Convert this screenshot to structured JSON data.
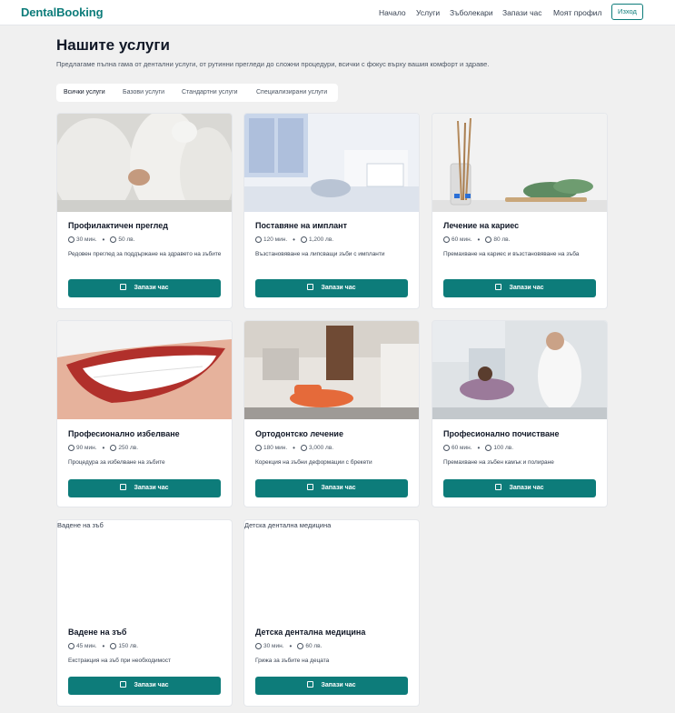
{
  "nav": {
    "brand": "DentalBooking",
    "links": [
      "Начало",
      "Услуги",
      "Зъболекари",
      "Запази час",
      "Моят профил"
    ],
    "logout": "Изход"
  },
  "page": {
    "title": "Нашите услуги",
    "subtitle": "Предлагаме пълна гама от дентални услуги, от рутинни прегледи до сложни процедури, всички с фокус върху вашия комфорт и здраве."
  },
  "tabs": [
    "Всички услуги",
    "Базови услуги",
    "Стандартни услуги",
    "Специализирани услуги"
  ],
  "book_label": "Запази час",
  "services": [
    {
      "title": "Профилактичен преглед",
      "duration": "30 мин.",
      "price": "50 лв.",
      "desc": "Редовен преглед за поддържане на здравето на зъбите",
      "image_alt": ""
    },
    {
      "title": "Поставяне на имплант",
      "duration": "120 мин.",
      "price": "1,200 лв.",
      "desc": "Възстановяване на липсващи зъби с импланти",
      "image_alt": ""
    },
    {
      "title": "Лечение на кариес",
      "duration": "60 мин.",
      "price": "80 лв.",
      "desc": "Премахване на кариес и възстановяване на зъба",
      "image_alt": ""
    },
    {
      "title": "Професионално избелване",
      "duration": "90 мин.",
      "price": "250 лв.",
      "desc": "Процедура за избелване на зъбите",
      "image_alt": ""
    },
    {
      "title": "Ортодонтско лечение",
      "duration": "180 мин.",
      "price": "3,000 лв.",
      "desc": "Корекция на зъбни деформации с брекети",
      "image_alt": ""
    },
    {
      "title": "Професионално почистване",
      "duration": "60 мин.",
      "price": "100 лв.",
      "desc": "Премахване на зъбен камък и полиране",
      "image_alt": ""
    },
    {
      "title": "Вадене на зъб",
      "duration": "45 мин.",
      "price": "150 лв.",
      "desc": "Екстракция на зъб при необходимост",
      "image_alt": "Вадене на зъб"
    },
    {
      "title": "Детска дентална медицина",
      "duration": "30 мин.",
      "price": "60 лв.",
      "desc": "Грижа за зъбите на децата",
      "image_alt": "Детска дентална медицина"
    }
  ],
  "colors": {
    "accent": "#0d7c7a",
    "background": "#f0f0f0",
    "card": "#ffffff"
  }
}
